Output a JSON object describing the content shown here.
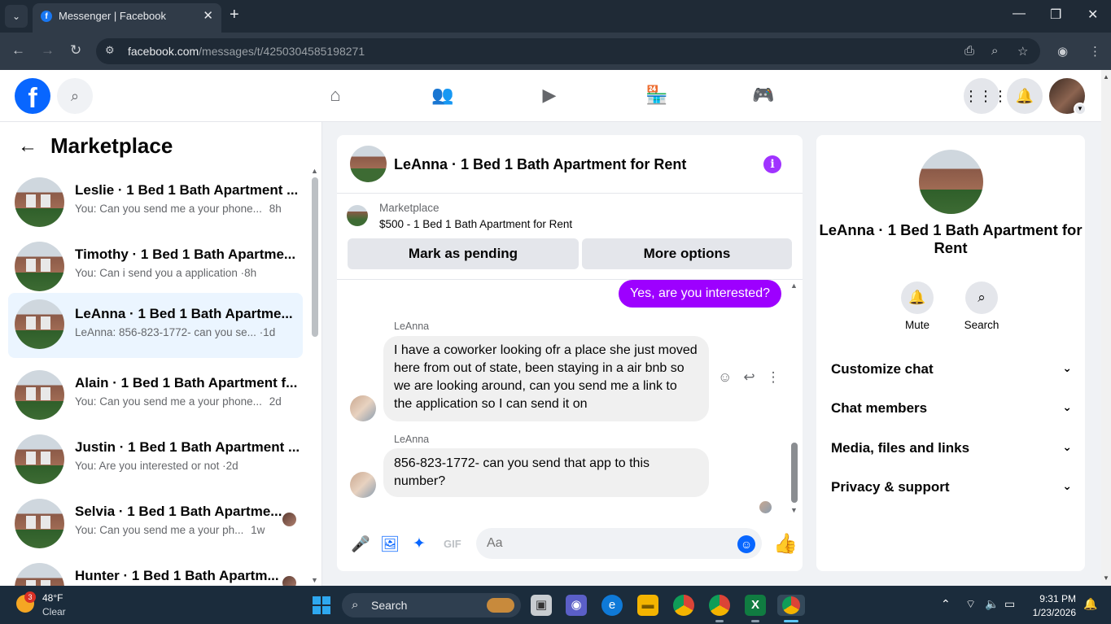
{
  "browser": {
    "tab_title": "Messenger | Facebook",
    "url_host": "facebook.com",
    "url_path": "/messages/t/4250304585198271"
  },
  "left": {
    "title": "Marketplace",
    "conversations": [
      {
        "name": "Leslie · 1 Bed 1 Bath Apartment ...",
        "preview": "You: Can you send me a your phone...",
        "time": "8h"
      },
      {
        "name": "Timothy · 1 Bed 1 Bath Apartme...",
        "preview": "You: Can i send you a application",
        "time": "·8h"
      },
      {
        "name": "LeAnna · 1 Bed 1 Bath Apartme...",
        "preview": "LeAnna: 856-823-1772- can you se...",
        "time": "·1d"
      },
      {
        "name": "Alain · 1 Bed 1 Bath Apartment f...",
        "preview": "You: Can you send me a your phone...",
        "time": "2d"
      },
      {
        "name": "Justin · 1 Bed 1 Bath Apartment ...",
        "preview": "You: Are you interested or not",
        "time": "·2d"
      },
      {
        "name": "Selvia · 1 Bed 1 Bath Apartme...",
        "preview": "You: Can you send me a your ph...",
        "time": "1w"
      },
      {
        "name": "Hunter · 1 Bed 1 Bath Apartm...",
        "preview": "",
        "time": ""
      }
    ]
  },
  "chat": {
    "title": "LeAnna · 1 Bed 1 Bath Apartment for Rent",
    "listing_source": "Marketplace",
    "listing_title": "$500 - 1 Bed 1 Bath Apartment for Rent",
    "btn_pending": "Mark as pending",
    "btn_more": "More options",
    "out_message": "Yes, are you interested?",
    "sender": "LeAnna",
    "msg1": "I have a coworker looking ofr a place she just moved here from out of state, been staying in a air bnb so we are looking around, can you send me a link to the application so I can send it on",
    "msg2": "856-823-1772- can you send that app to this number?",
    "input_placeholder": "Aa"
  },
  "right": {
    "name": "LeAnna · 1 Bed 1 Bath Apartment for Rent",
    "mute": "Mute",
    "search": "Search",
    "sections": [
      "Customize chat",
      "Chat members",
      "Media, files and links",
      "Privacy & support"
    ]
  },
  "taskbar": {
    "temp": "48°F",
    "weather": "Clear",
    "badge": "3",
    "search": "Search",
    "time": "9:31 PM",
    "date": "1/23/2026"
  },
  "colors": {
    "accent": "#9d00ff",
    "fb_blue": "#0866ff"
  }
}
